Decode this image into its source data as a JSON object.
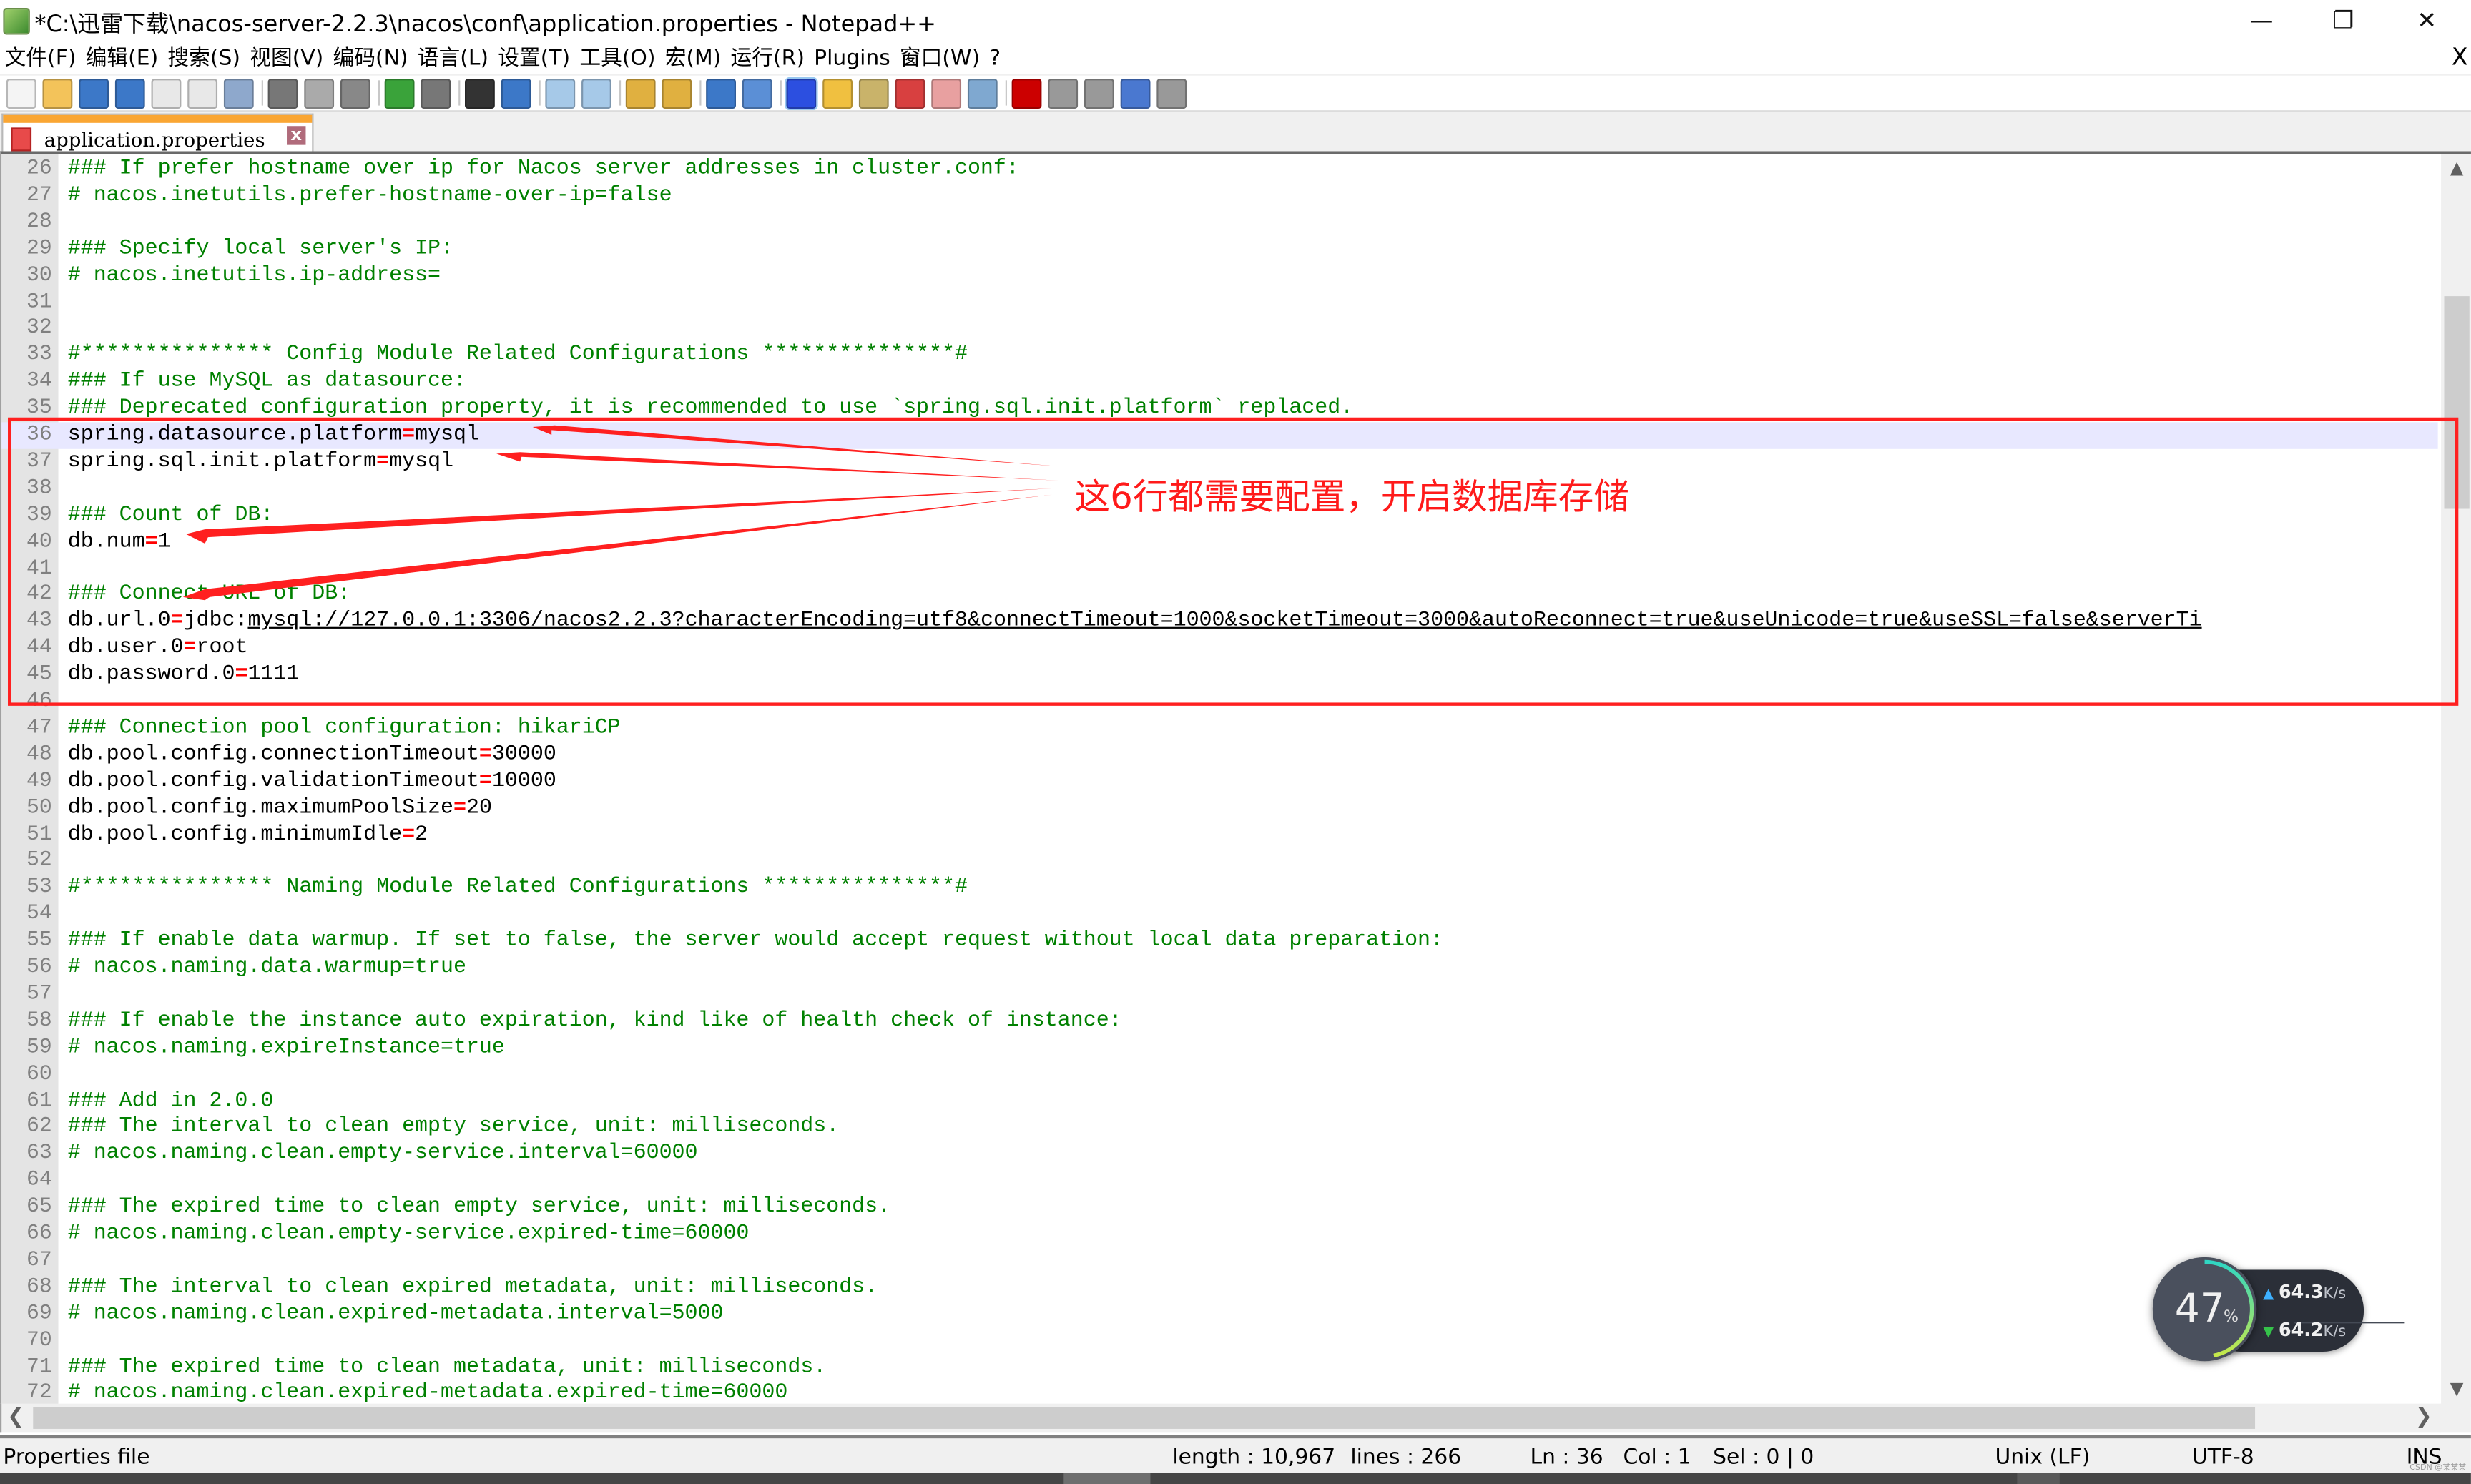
{
  "window": {
    "title": "*C:\\迅雷下载\\nacos-server-2.2.3\\nacos\\conf\\application.properties - Notepad++",
    "controls": {
      "minimize": "—",
      "restore": "❐",
      "close": "✕"
    }
  },
  "menu": {
    "items": [
      "文件(F)",
      "编辑(E)",
      "搜索(S)",
      "视图(V)",
      "编码(N)",
      "语言(L)",
      "设置(T)",
      "工具(O)",
      "宏(M)",
      "运行(R)",
      "Plugins",
      "窗口(W)",
      "?"
    ],
    "close_doc": "X"
  },
  "toolbar": {
    "buttons": [
      "new-file",
      "open-file",
      "save",
      "save-all",
      "close",
      "close-all",
      "print",
      "cut",
      "copy",
      "paste",
      "undo",
      "redo",
      "find",
      "replace",
      "zoom-in",
      "zoom-out",
      "sync-vertical",
      "sync-horizontal",
      "word-wrap",
      "show-all-chars",
      "indent-guide",
      "user-defined-language",
      "document-map",
      "function-list",
      "folder-as-workspace",
      "monitoring",
      "record-macro",
      "stop-recording",
      "playback-macro",
      "run-macro-multiple",
      "save-macro"
    ]
  },
  "tab": {
    "label": "application.properties",
    "close": "x"
  },
  "editor": {
    "current_line": 36,
    "lines": [
      {
        "n": "26",
        "type": "comment",
        "text": "### If prefer hostname over ip for Nacos server addresses in cluster.conf:"
      },
      {
        "n": "27",
        "type": "comment",
        "text": "# nacos.inetutils.prefer-hostname-over-ip=false"
      },
      {
        "n": "28",
        "type": "blank",
        "text": ""
      },
      {
        "n": "29",
        "type": "comment",
        "text": "### Specify local server's IP:"
      },
      {
        "n": "30",
        "type": "comment",
        "text": "# nacos.inetutils.ip-address="
      },
      {
        "n": "31",
        "type": "blank",
        "text": ""
      },
      {
        "n": "32",
        "type": "blank",
        "text": ""
      },
      {
        "n": "33",
        "type": "comment",
        "text": "#*************** Config Module Related Configurations ***************#"
      },
      {
        "n": "34",
        "type": "comment",
        "text": "### If use MySQL as datasource:"
      },
      {
        "n": "35",
        "type": "comment",
        "text": "### Deprecated configuration property, it is recommended to use `spring.sql.init.platform` replaced."
      },
      {
        "n": "36",
        "type": "kv",
        "key": "spring.datasource.platform",
        "value": "mysql"
      },
      {
        "n": "37",
        "type": "kv",
        "key": "spring.sql.init.platform",
        "value": "mysql"
      },
      {
        "n": "38",
        "type": "blank",
        "text": ""
      },
      {
        "n": "39",
        "type": "comment",
        "text": "### Count of DB:"
      },
      {
        "n": "40",
        "type": "kv",
        "key": "db.num",
        "value": "1"
      },
      {
        "n": "41",
        "type": "blank",
        "text": ""
      },
      {
        "n": "42",
        "type": "comment",
        "text": "### Connect URL of DB:"
      },
      {
        "n": "43",
        "type": "kv-url",
        "key": "db.url.0",
        "prefix": "jdbc:",
        "value": "mysql://127.0.0.1:3306/nacos2.2.3?characterEncoding=utf8&connectTimeout=1000&socketTimeout=3000&autoReconnect=true&useUnicode=true&useSSL=false&serverTi"
      },
      {
        "n": "44",
        "type": "kv",
        "key": "db.user.0",
        "value": "root"
      },
      {
        "n": "45",
        "type": "kv",
        "key": "db.password.0",
        "value": "1111"
      },
      {
        "n": "46",
        "type": "blank",
        "text": ""
      },
      {
        "n": "47",
        "type": "comment",
        "text": "### Connection pool configuration: hikariCP"
      },
      {
        "n": "48",
        "type": "kv",
        "key": "db.pool.config.connectionTimeout",
        "value": "30000"
      },
      {
        "n": "49",
        "type": "kv",
        "key": "db.pool.config.validationTimeout",
        "value": "10000"
      },
      {
        "n": "50",
        "type": "kv",
        "key": "db.pool.config.maximumPoolSize",
        "value": "20"
      },
      {
        "n": "51",
        "type": "kv",
        "key": "db.pool.config.minimumIdle",
        "value": "2"
      },
      {
        "n": "52",
        "type": "blank",
        "text": ""
      },
      {
        "n": "53",
        "type": "comment",
        "text": "#*************** Naming Module Related Configurations ***************#"
      },
      {
        "n": "54",
        "type": "blank",
        "text": ""
      },
      {
        "n": "55",
        "type": "comment",
        "text": "### If enable data warmup. If set to false, the server would accept request without local data preparation:"
      },
      {
        "n": "56",
        "type": "comment",
        "text": "# nacos.naming.data.warmup=true"
      },
      {
        "n": "57",
        "type": "blank",
        "text": ""
      },
      {
        "n": "58",
        "type": "comment",
        "text": "### If enable the instance auto expiration, kind like of health check of instance:"
      },
      {
        "n": "59",
        "type": "comment",
        "text": "# nacos.naming.expireInstance=true"
      },
      {
        "n": "60",
        "type": "blank",
        "text": ""
      },
      {
        "n": "61",
        "type": "comment",
        "text": "### Add in 2.0.0"
      },
      {
        "n": "62",
        "type": "comment",
        "text": "### The interval to clean empty service, unit: milliseconds."
      },
      {
        "n": "63",
        "type": "comment",
        "text": "# nacos.naming.clean.empty-service.interval=60000"
      },
      {
        "n": "64",
        "type": "blank",
        "text": ""
      },
      {
        "n": "65",
        "type": "comment",
        "text": "### The expired time to clean empty service, unit: milliseconds."
      },
      {
        "n": "66",
        "type": "comment",
        "text": "# nacos.naming.clean.empty-service.expired-time=60000"
      },
      {
        "n": "67",
        "type": "blank",
        "text": ""
      },
      {
        "n": "68",
        "type": "comment",
        "text": "### The interval to clean expired metadata, unit: milliseconds."
      },
      {
        "n": "69",
        "type": "comment",
        "text": "# nacos.naming.clean.expired-metadata.interval=5000"
      },
      {
        "n": "70",
        "type": "blank",
        "text": ""
      },
      {
        "n": "71",
        "type": "comment",
        "text": "### The expired time to clean metadata, unit: milliseconds."
      },
      {
        "n": "72",
        "type": "comment",
        "text": "# nacos.naming.clean.expired-metadata.expired-time=60000"
      }
    ]
  },
  "annotation": {
    "text": "这6行都需要配置，开启数据库存储",
    "color": "#ff1a1a",
    "targets": [
      "36",
      "37",
      "40",
      "43"
    ]
  },
  "statusbar": {
    "file_type": "Properties file",
    "length": "length : 10,967",
    "lines": "lines : 266",
    "ln": "Ln : 36",
    "col": "Col : 1",
    "sel": "Sel : 0 | 0",
    "eol": "Unix (LF)",
    "encoding": "UTF-8",
    "mode": "INS"
  },
  "net_monitor": {
    "percent": "47",
    "percent_sign": "%",
    "upload": "64.3",
    "download": "64.2",
    "unit": "K/s"
  },
  "scrollbar": {
    "up": "▲",
    "down": "▼",
    "left": "❮",
    "right": "❯"
  },
  "watermark": "CSDN @某某某"
}
